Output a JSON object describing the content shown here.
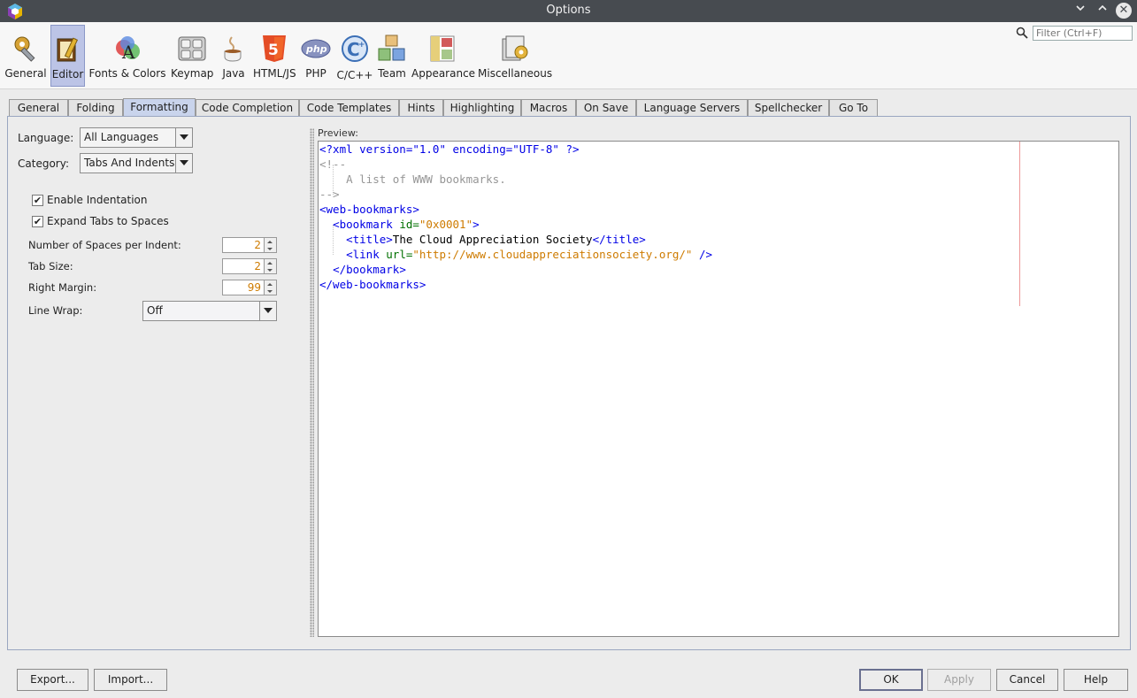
{
  "window": {
    "title": "Options"
  },
  "toolbar": {
    "items": [
      {
        "label": "General",
        "icon": "wrench-gear-icon"
      },
      {
        "label": "Editor",
        "icon": "editor-pencil-icon",
        "selected": true
      },
      {
        "label": "Fonts & Colors",
        "icon": "fonts-colors-icon"
      },
      {
        "label": "Keymap",
        "icon": "keyboard-icon"
      },
      {
        "label": "Java",
        "icon": "java-cup-icon"
      },
      {
        "label": "HTML/JS",
        "icon": "html5-icon"
      },
      {
        "label": "PHP",
        "icon": "php-icon"
      },
      {
        "label": "C/C++",
        "icon": "cpp-icon"
      },
      {
        "label": "Team",
        "icon": "team-cubes-icon"
      },
      {
        "label": "Appearance",
        "icon": "appearance-icon"
      },
      {
        "label": "Miscellaneous",
        "icon": "miscellaneous-icon"
      }
    ]
  },
  "filter": {
    "placeholder": "Filter (Ctrl+F)"
  },
  "tabs": [
    "General",
    "Folding",
    "Formatting",
    "Code Completion",
    "Code Templates",
    "Hints",
    "Highlighting",
    "Macros",
    "On Save",
    "Language Servers",
    "Spellchecker",
    "Go To"
  ],
  "active_tab": "Formatting",
  "form": {
    "language_label": "Language:",
    "language_value": "All Languages",
    "category_label": "Category:",
    "category_value": "Tabs And Indents",
    "enable_indentation": "Enable Indentation",
    "expand_tabs": "Expand Tabs to Spaces",
    "spaces_per_indent_label": "Number of Spaces per Indent:",
    "spaces_per_indent": "2",
    "tab_size_label": "Tab Size:",
    "tab_size": "2",
    "right_margin_label": "Right Margin:",
    "right_margin": "99",
    "line_wrap_label": "Line Wrap:",
    "line_wrap_value": "Off"
  },
  "preview": {
    "label": "Preview:",
    "l1_a": "<?xml version=\"1.0\" encoding=\"UTF-8\" ?>",
    "l2": "<!--",
    "l3": "A list of WWW bookmarks.",
    "l4": "-->",
    "l5": "<web-bookmarks>",
    "l6_tag": "<bookmark ",
    "l6_attr": "id=",
    "l6_val": "\"0x0001\"",
    "l6_end": ">",
    "l7_tag": "<title>",
    "l7_txt": "The Cloud Appreciation Society",
    "l7_end": "</title>",
    "l8_tag": "<link ",
    "l8_attr": "url=",
    "l8_val": "\"http://www.cloudappreciationsociety.org/\"",
    "l8_end": " />",
    "l9": "</bookmark>",
    "l10": "</web-bookmarks>"
  },
  "buttons": {
    "export": "Export...",
    "import": "Import...",
    "ok": "OK",
    "apply": "Apply",
    "cancel": "Cancel",
    "help": "Help"
  }
}
